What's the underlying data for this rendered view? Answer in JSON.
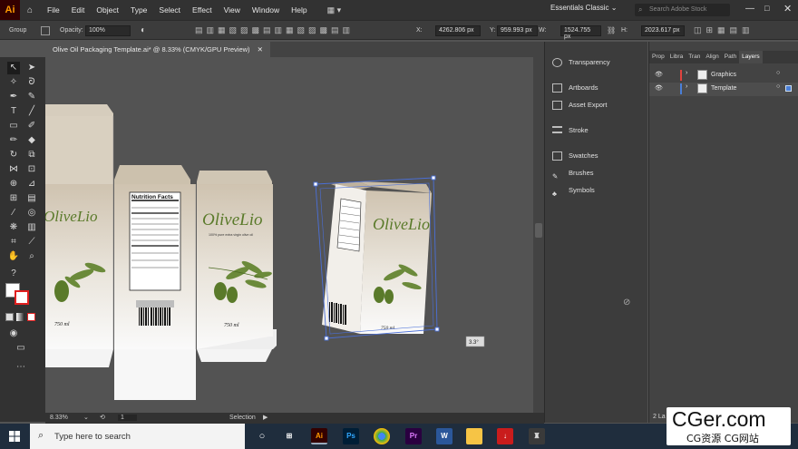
{
  "menubar": {
    "app_logo": "Ai",
    "items": [
      "File",
      "Edit",
      "Object",
      "Type",
      "Select",
      "Effect",
      "View",
      "Window",
      "Help"
    ],
    "workspace": "Essentials Classic",
    "search_placeholder": "Search Adobe Stock"
  },
  "controlbar": {
    "selection_label": "Group",
    "opacity_label": "Opacity:",
    "opacity_value": "100%",
    "x_label": "X:",
    "x_value": "4262.806 px",
    "y_label": "Y:",
    "y_value": "959.993 px",
    "w_label": "W:",
    "w_value": "1524.755 px",
    "h_label": "H:",
    "h_value": "2023.617 px"
  },
  "document": {
    "tab_title": "Olive Oil Packaging Template.ai* @ 8.33% (CMYK/GPU Preview)"
  },
  "canvas": {
    "brand": "OliveLio",
    "tagline": "100% pure extra virgin olive oil",
    "volume": "750 ml",
    "nutrition_title": "Nutrition Facts",
    "rotation_tooltip": "3.3°"
  },
  "status": {
    "zoom": "8.33%",
    "artboard": "1",
    "tool": "Selection"
  },
  "dock": {
    "items": [
      "Transparency",
      "Artboards",
      "Asset Export",
      "Stroke",
      "Swatches",
      "Brushes",
      "Symbols"
    ]
  },
  "layers": {
    "tabs": [
      "Prop",
      "Libra",
      "Tran",
      "Align",
      "Path",
      "Layers"
    ],
    "rows": [
      {
        "name": "Graphics",
        "color": "#e0433f"
      },
      {
        "name": "Template",
        "color": "#4a7fd8"
      }
    ],
    "footer": "2 La"
  },
  "taskbar": {
    "search_placeholder": "Type here to search",
    "apps": [
      "Ai",
      "Ps",
      "Pr"
    ]
  },
  "watermark": {
    "title": "CGer.com",
    "subtitle": "CG资源 CG网站"
  },
  "colors": {
    "brand_green": "#5a7a2a",
    "accent_blue": "#4a6fd8"
  }
}
